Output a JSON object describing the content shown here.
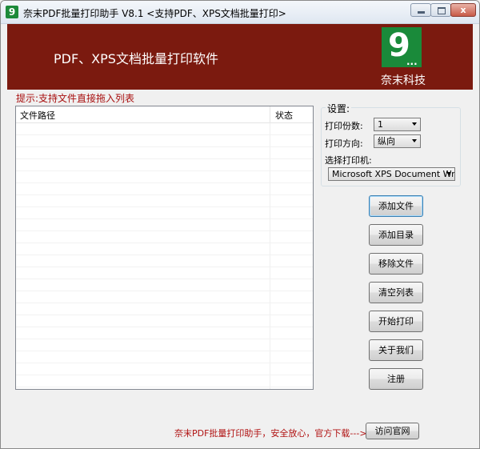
{
  "window": {
    "title": "奈末PDF批量打印助手 V8.1   <支持PDF、XPS文档批量打印>",
    "app_icon": "9",
    "controls": {
      "minimize": "minimize-icon",
      "maximize": "maximize-icon",
      "close": "x"
    }
  },
  "banner": {
    "title": "PDF、XPS文档批量打印软件",
    "logo_digit": "9",
    "logo_dots": "...",
    "company": "奈末科技"
  },
  "hint": "提示:支持文件直接拖入列表",
  "file_list": {
    "columns": [
      "文件路径",
      "状态"
    ],
    "rows": []
  },
  "settings": {
    "group_label": "设置:",
    "copies_label": "打印份数:",
    "copies_value": "1",
    "orientation_label": "打印方向:",
    "orientation_value": "纵向",
    "printer_label": "选择打印机:",
    "printer_value": "Microsoft XPS Document Writer"
  },
  "buttons": {
    "add_file": "添加文件",
    "add_folder": "添加目录",
    "remove_file": "移除文件",
    "clear_list": "清空列表",
    "start_print": "开始打印",
    "about": "关于我们",
    "register": "注册"
  },
  "footer": {
    "text": "奈末PDF批量打印助手，安全放心，官方下载--->>",
    "visit_button": "访问官网"
  },
  "colors": {
    "banner": "#7b1a0f",
    "logo": "#1a8a3a",
    "hint_text": "#a81010",
    "footer_text": "#b01010"
  }
}
